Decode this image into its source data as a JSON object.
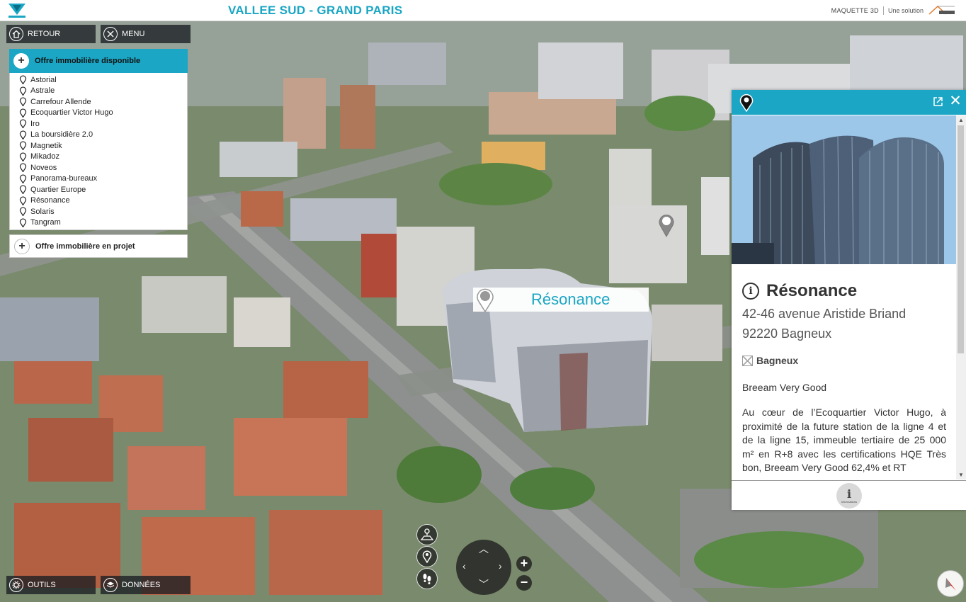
{
  "header": {
    "site_title": "VALLEE SUD - GRAND PARIS",
    "product": "MAQUETTE 3D",
    "tagline": "Une solution"
  },
  "top_buttons": {
    "back_label": "RETOUR",
    "menu_label": "MENU"
  },
  "sidebar": {
    "section_available": "Offre immobilière disponible",
    "items": [
      {
        "label": "Astorial"
      },
      {
        "label": "Astrale"
      },
      {
        "label": "Carrefour Allende"
      },
      {
        "label": "Ecoquartier Victor Hugo"
      },
      {
        "label": "Iro"
      },
      {
        "label": "La boursidière 2.0"
      },
      {
        "label": "Magnetik"
      },
      {
        "label": "Mikadoz"
      },
      {
        "label": "Noveos"
      },
      {
        "label": "Panorama-bureaux"
      },
      {
        "label": "Quartier Europe"
      },
      {
        "label": "Résonance"
      },
      {
        "label": "Solaris"
      },
      {
        "label": "Tangram"
      }
    ],
    "section_project": "Offre immobilière en projet"
  },
  "map": {
    "selected_label": "Résonance"
  },
  "info_panel": {
    "title": "Résonance",
    "address_line1": "42-46 avenue Aristide Briand",
    "address_line2": "92220 Bagneux",
    "city": "Bagneux",
    "certification": "Breeam Very Good",
    "description": "Au cœur de l’Ecoquartier Victor Hugo, à proximité de la future station de la ligne 4 et de la ligne 15, immeuble tertiaire de 25 000 m² en R+8 avec les certifications HQE Très bon, Breeam Very Good 62,4% et RT",
    "footer_tab": "Informations"
  },
  "bottom_buttons": {
    "tools_label": "OUTILS",
    "data_label": "DONNÉES"
  },
  "colors": {
    "accent": "#1aa6c4",
    "toolbar_bg": "#1e2328"
  }
}
